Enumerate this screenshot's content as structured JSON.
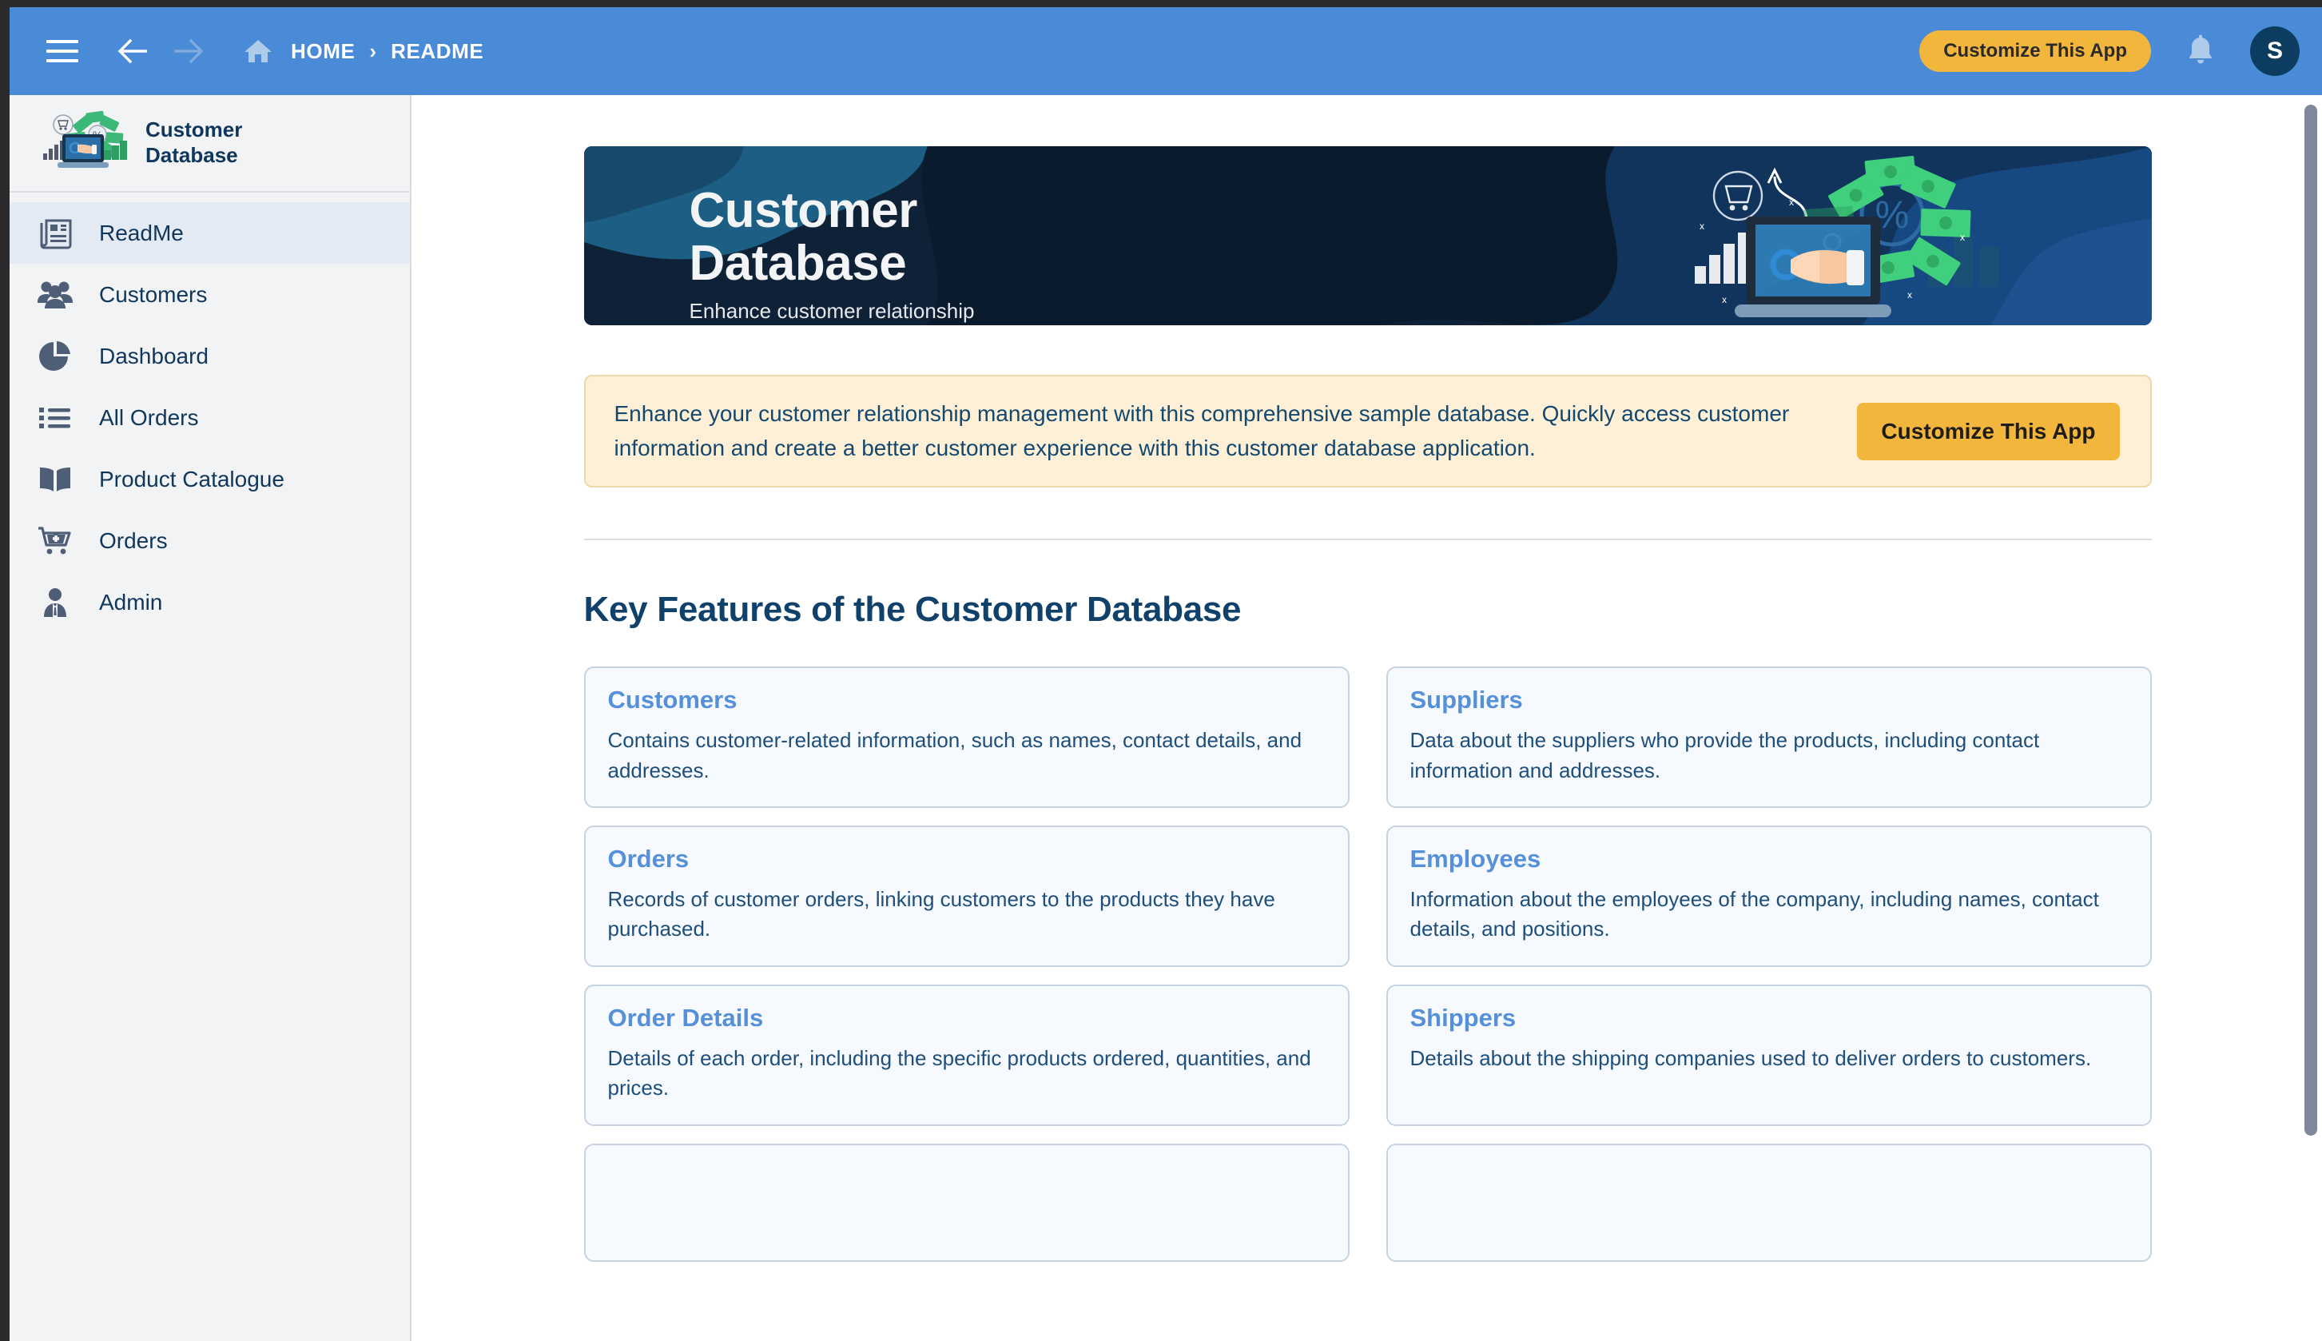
{
  "topbar": {
    "menu_icon": "hamburger-menu-icon",
    "back_icon": "arrow-left-icon",
    "forward_icon": "arrow-right-icon",
    "home_icon": "home-icon",
    "home_label": "HOME",
    "separator": "›",
    "current_label": "README",
    "customize_label": "Customize This App",
    "bell_icon": "bell-icon",
    "avatar_initial": "S",
    "colors": {
      "bar": "#4a8bd8",
      "pill": "#f2b63c",
      "avatar": "#0d3c61"
    }
  },
  "sidebar": {
    "brand_title": "Customer\nDatabase",
    "logo_icon": "customer-database-logo",
    "items": [
      {
        "label": "ReadMe",
        "icon": "newspaper-icon",
        "active": true
      },
      {
        "label": "Customers",
        "icon": "people-group-icon",
        "active": false
      },
      {
        "label": "Dashboard",
        "icon": "pie-chart-icon",
        "active": false
      },
      {
        "label": "All Orders",
        "icon": "bulleted-list-icon",
        "active": false
      },
      {
        "label": "Product Catalogue",
        "icon": "open-book-icon",
        "active": false
      },
      {
        "label": "Orders",
        "icon": "cart-plus-icon",
        "active": false
      },
      {
        "label": "Admin",
        "icon": "user-tie-icon",
        "active": false
      }
    ]
  },
  "main": {
    "hero": {
      "title": "Customer\nDatabase",
      "subtitle": "Enhance customer relationship",
      "art_icon": "laptop-hand-money-illustration",
      "bg_color": "#0e2136"
    },
    "callout": {
      "text": "Enhance your customer relationship management with this comprehensive sample database. Quickly access customer information and create a better customer experience with this customer database application.",
      "button_label": "Customize This App",
      "bg_color": "#fdf0d6",
      "button_color": "#f2b63c"
    },
    "section_title": "Key Features of the Customer Database",
    "features": [
      {
        "title": "Customers",
        "desc": "Contains customer-related information, such as names, contact details, and addresses."
      },
      {
        "title": "Suppliers",
        "desc": "Data about the suppliers who provide the products, including contact information and addresses."
      },
      {
        "title": "Orders",
        "desc": "Records of customer orders, linking customers to the products they have purchased."
      },
      {
        "title": "Employees",
        "desc": "Information about the employees of the company, including names, contact details, and positions."
      },
      {
        "title": "Order Details",
        "desc": "Details of each order, including the specific products ordered, quantities, and prices."
      },
      {
        "title": "Shippers",
        "desc": "Details about the shipping companies used to deliver orders to customers."
      },
      {
        "title": "",
        "desc": ""
      },
      {
        "title": "",
        "desc": ""
      }
    ]
  }
}
